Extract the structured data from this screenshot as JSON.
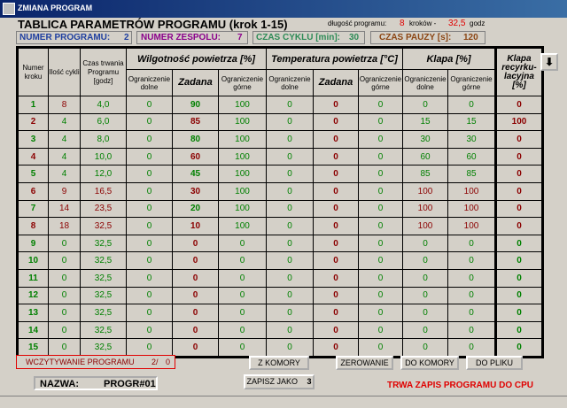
{
  "window": {
    "title": "ZMIANA PROGRAM"
  },
  "header": {
    "title": "TABLICA PARAMETRÓW PROGRAMU (krok 1-15)",
    "length_label": "długość programu:",
    "steps_count": "8",
    "steps_unit": "kroków -",
    "hours": "32,5",
    "hours_unit": "godz"
  },
  "info": {
    "program_no_label": "NUMER PROGRAMU:",
    "program_no": "2",
    "team_no_label": "NUMER ZESPOLU:",
    "team_no": "7",
    "cycle_label": "CZAS CYKLU [min]:",
    "cycle": "30",
    "pause_label": "CZAS PAUZY [s]:",
    "pause": "120"
  },
  "table": {
    "col_step": "Numer kroku",
    "col_cycles": "Ilość cykli",
    "col_duration": "Czas trwania Programu [godz]",
    "group_humidity": "Wilgotność powietrza [%]",
    "group_temperature": "Temperatura powietrza [°C]",
    "group_damper": "Klapa [%]",
    "group_recirc": "Klapa recyrku-lacyjna [%]",
    "sub_lower": "Ograniczenie dolne",
    "sub_set": "Zadana",
    "sub_upper": "Ograniczenie górne",
    "rows": [
      {
        "step": "1",
        "cycles": "8",
        "dur": "4,0",
        "h_lo": "0",
        "h_set": "90",
        "h_hi": "100",
        "t_lo": "0",
        "t_set": "0",
        "t_hi": "0",
        "k_lo": "0",
        "k_hi": "0",
        "rec": "0",
        "active": true
      },
      {
        "step": "2",
        "cycles": "4",
        "dur": "6,0",
        "h_lo": "0",
        "h_set": "85",
        "h_hi": "100",
        "t_lo": "0",
        "t_set": "0",
        "t_hi": "0",
        "k_lo": "15",
        "k_hi": "15",
        "rec": "100",
        "active": true
      },
      {
        "step": "3",
        "cycles": "4",
        "dur": "8,0",
        "h_lo": "0",
        "h_set": "80",
        "h_hi": "100",
        "t_lo": "0",
        "t_set": "0",
        "t_hi": "0",
        "k_lo": "30",
        "k_hi": "30",
        "rec": "0",
        "active": true
      },
      {
        "step": "4",
        "cycles": "4",
        "dur": "10,0",
        "h_lo": "0",
        "h_set": "60",
        "h_hi": "100",
        "t_lo": "0",
        "t_set": "0",
        "t_hi": "0",
        "k_lo": "60",
        "k_hi": "60",
        "rec": "0",
        "active": true
      },
      {
        "step": "5",
        "cycles": "4",
        "dur": "12,0",
        "h_lo": "0",
        "h_set": "45",
        "h_hi": "100",
        "t_lo": "0",
        "t_set": "0",
        "t_hi": "0",
        "k_lo": "85",
        "k_hi": "85",
        "rec": "0",
        "active": true
      },
      {
        "step": "6",
        "cycles": "9",
        "dur": "16,5",
        "h_lo": "0",
        "h_set": "30",
        "h_hi": "100",
        "t_lo": "0",
        "t_set": "0",
        "t_hi": "0",
        "k_lo": "100",
        "k_hi": "100",
        "rec": "0",
        "active": true
      },
      {
        "step": "7",
        "cycles": "14",
        "dur": "23,5",
        "h_lo": "0",
        "h_set": "20",
        "h_hi": "100",
        "t_lo": "0",
        "t_set": "0",
        "t_hi": "0",
        "k_lo": "100",
        "k_hi": "100",
        "rec": "0",
        "active": true
      },
      {
        "step": "8",
        "cycles": "18",
        "dur": "32,5",
        "h_lo": "0",
        "h_set": "10",
        "h_hi": "100",
        "t_lo": "0",
        "t_set": "0",
        "t_hi": "0",
        "k_lo": "100",
        "k_hi": "100",
        "rec": "0",
        "active": true
      },
      {
        "step": "9",
        "cycles": "0",
        "dur": "32,5",
        "h_lo": "0",
        "h_set": "0",
        "h_hi": "0",
        "t_lo": "0",
        "t_set": "0",
        "t_hi": "0",
        "k_lo": "0",
        "k_hi": "0",
        "rec": "0",
        "active": false
      },
      {
        "step": "10",
        "cycles": "0",
        "dur": "32,5",
        "h_lo": "0",
        "h_set": "0",
        "h_hi": "0",
        "t_lo": "0",
        "t_set": "0",
        "t_hi": "0",
        "k_lo": "0",
        "k_hi": "0",
        "rec": "0",
        "active": false
      },
      {
        "step": "11",
        "cycles": "0",
        "dur": "32,5",
        "h_lo": "0",
        "h_set": "0",
        "h_hi": "0",
        "t_lo": "0",
        "t_set": "0",
        "t_hi": "0",
        "k_lo": "0",
        "k_hi": "0",
        "rec": "0",
        "active": false
      },
      {
        "step": "12",
        "cycles": "0",
        "dur": "32,5",
        "h_lo": "0",
        "h_set": "0",
        "h_hi": "0",
        "t_lo": "0",
        "t_set": "0",
        "t_hi": "0",
        "k_lo": "0",
        "k_hi": "0",
        "rec": "0",
        "active": false
      },
      {
        "step": "13",
        "cycles": "0",
        "dur": "32,5",
        "h_lo": "0",
        "h_set": "0",
        "h_hi": "0",
        "t_lo": "0",
        "t_set": "0",
        "t_hi": "0",
        "k_lo": "0",
        "k_hi": "0",
        "rec": "0",
        "active": false
      },
      {
        "step": "14",
        "cycles": "0",
        "dur": "32,5",
        "h_lo": "0",
        "h_set": "0",
        "h_hi": "0",
        "t_lo": "0",
        "t_set": "0",
        "t_hi": "0",
        "k_lo": "0",
        "k_hi": "0",
        "rec": "0",
        "active": false
      },
      {
        "step": "15",
        "cycles": "0",
        "dur": "32,5",
        "h_lo": "0",
        "h_set": "0",
        "h_hi": "0",
        "t_lo": "0",
        "t_set": "0",
        "t_hi": "0",
        "k_lo": "0",
        "k_hi": "0",
        "rec": "0",
        "active": false
      }
    ]
  },
  "status": {
    "label": "WCZYTYWANIE PROGRAMU",
    "progress": "2/",
    "count": "0"
  },
  "buttons": {
    "from_chamber": "Z KOMORY",
    "reset": "ZEROWANIE",
    "to_chamber": "DO KOMORY",
    "to_file": "DO PLIKU",
    "save_as": "ZAPISZ JAKO",
    "save_as_no": "3",
    "arrow": "⬇"
  },
  "name": {
    "label": "NAZWA:",
    "value": "PROGR#01"
  },
  "message": "TRWA ZAPIS PROGRAMU DO CPU",
  "colors": {
    "green": "#008000",
    "red": "#8b0000",
    "alert": "#e00000",
    "title_bar": "#0a246a"
  }
}
